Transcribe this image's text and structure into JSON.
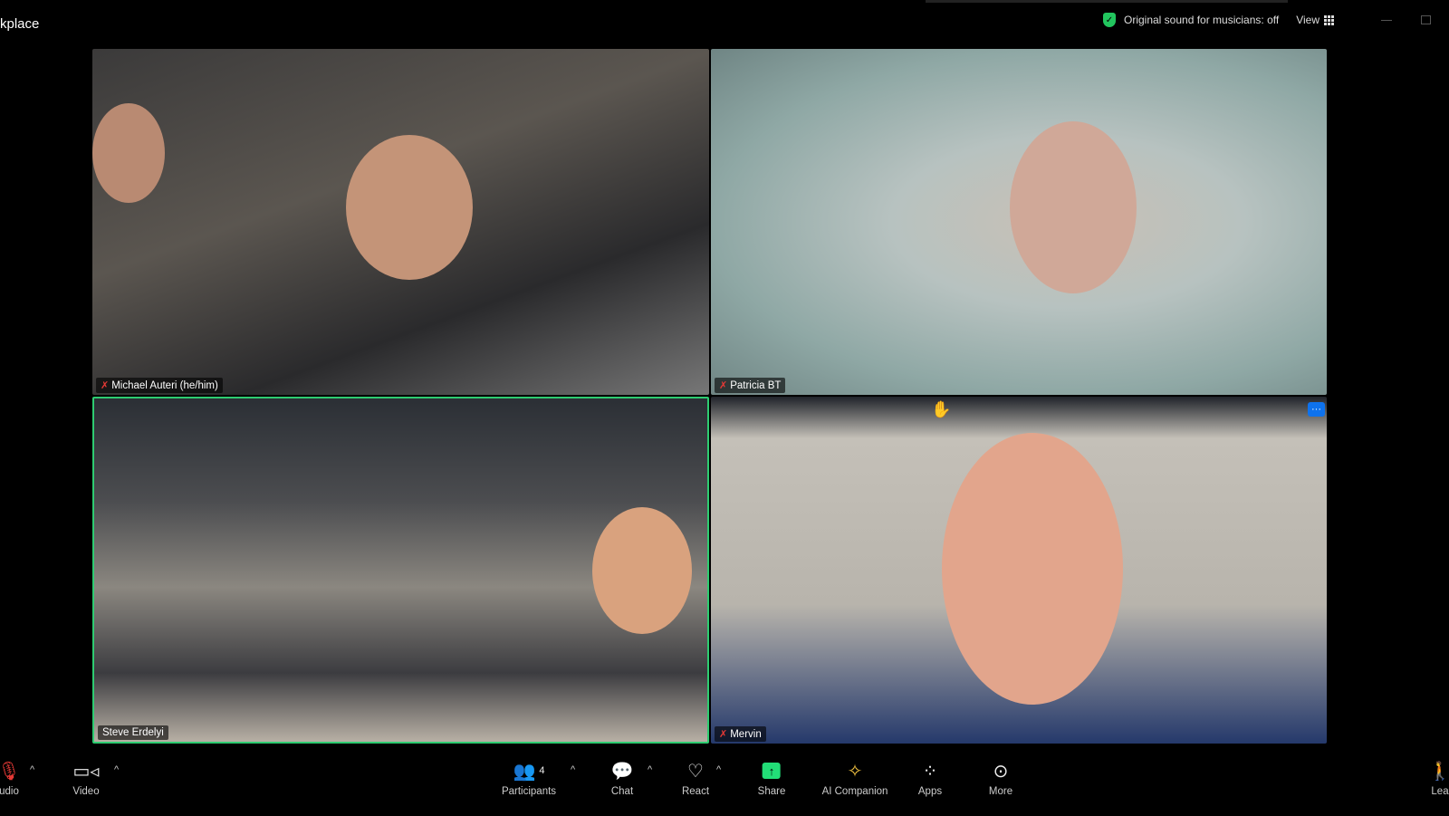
{
  "window": {
    "title": "kplace"
  },
  "header": {
    "original_sound": "Original sound for musicians: off",
    "view_label": "View",
    "shield_color": "#22c55e"
  },
  "tiles": [
    {
      "name": "Michael Auteri (he/him)",
      "muted": true
    },
    {
      "name": "Patricia BT",
      "muted": true
    },
    {
      "name": "Steve Erdelyi",
      "muted": false,
      "active_speaker": true
    },
    {
      "name": "Mervin",
      "muted": true,
      "hand_raised": true,
      "more_label": "···"
    }
  ],
  "toolbar": {
    "audio": "udio",
    "video": "Video",
    "participants": "Participants",
    "participants_count": "4",
    "chat": "Chat",
    "react": "React",
    "share": "Share",
    "ai_companion": "AI Companion",
    "apps": "Apps",
    "more": "More",
    "leave": "Lea"
  }
}
